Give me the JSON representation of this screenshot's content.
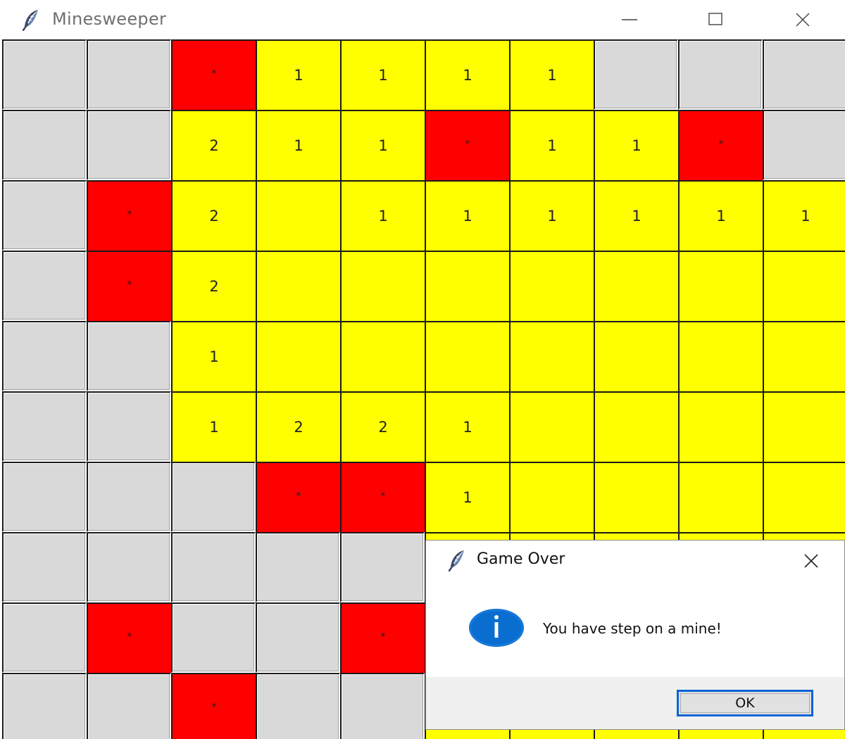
{
  "window": {
    "title": "Minesweeper",
    "icon": "feather-icon",
    "controls": [
      "minimize-icon",
      "maximize-icon",
      "close-icon"
    ]
  },
  "board": {
    "rows": 10,
    "cols": 10,
    "cell_colors": {
      "hidden": "#d9d9d9",
      "open": "#ffff00",
      "mine": "#ff0000"
    },
    "cells": [
      [
        {
          "s": "hidden",
          "t": ""
        },
        {
          "s": "hidden",
          "t": ""
        },
        {
          "s": "mine",
          "t": "*"
        },
        {
          "s": "open",
          "t": "1"
        },
        {
          "s": "open",
          "t": "1"
        },
        {
          "s": "open",
          "t": "1"
        },
        {
          "s": "open",
          "t": "1"
        },
        {
          "s": "hidden",
          "t": ""
        },
        {
          "s": "hidden",
          "t": ""
        },
        {
          "s": "hidden",
          "t": ""
        }
      ],
      [
        {
          "s": "hidden",
          "t": ""
        },
        {
          "s": "hidden",
          "t": ""
        },
        {
          "s": "open",
          "t": "2"
        },
        {
          "s": "open",
          "t": "1"
        },
        {
          "s": "open",
          "t": "1"
        },
        {
          "s": "mine",
          "t": "*"
        },
        {
          "s": "open",
          "t": "1"
        },
        {
          "s": "open",
          "t": "1"
        },
        {
          "s": "mine",
          "t": "*"
        },
        {
          "s": "hidden",
          "t": ""
        }
      ],
      [
        {
          "s": "hidden",
          "t": ""
        },
        {
          "s": "mine",
          "t": "*"
        },
        {
          "s": "open",
          "t": "2"
        },
        {
          "s": "open",
          "t": ""
        },
        {
          "s": "open",
          "t": "1"
        },
        {
          "s": "open",
          "t": "1"
        },
        {
          "s": "open",
          "t": "1"
        },
        {
          "s": "open",
          "t": "1"
        },
        {
          "s": "open",
          "t": "1"
        },
        {
          "s": "open",
          "t": "1"
        }
      ],
      [
        {
          "s": "hidden",
          "t": ""
        },
        {
          "s": "mine",
          "t": "*"
        },
        {
          "s": "open",
          "t": "2"
        },
        {
          "s": "open",
          "t": ""
        },
        {
          "s": "open",
          "t": ""
        },
        {
          "s": "open",
          "t": ""
        },
        {
          "s": "open",
          "t": ""
        },
        {
          "s": "open",
          "t": ""
        },
        {
          "s": "open",
          "t": ""
        },
        {
          "s": "open",
          "t": ""
        }
      ],
      [
        {
          "s": "hidden",
          "t": ""
        },
        {
          "s": "hidden",
          "t": ""
        },
        {
          "s": "open",
          "t": "1"
        },
        {
          "s": "open",
          "t": ""
        },
        {
          "s": "open",
          "t": ""
        },
        {
          "s": "open",
          "t": ""
        },
        {
          "s": "open",
          "t": ""
        },
        {
          "s": "open",
          "t": ""
        },
        {
          "s": "open",
          "t": ""
        },
        {
          "s": "open",
          "t": ""
        }
      ],
      [
        {
          "s": "hidden",
          "t": ""
        },
        {
          "s": "hidden",
          "t": ""
        },
        {
          "s": "open",
          "t": "1"
        },
        {
          "s": "open",
          "t": "2"
        },
        {
          "s": "open",
          "t": "2"
        },
        {
          "s": "open",
          "t": "1"
        },
        {
          "s": "open",
          "t": ""
        },
        {
          "s": "open",
          "t": ""
        },
        {
          "s": "open",
          "t": ""
        },
        {
          "s": "open",
          "t": ""
        }
      ],
      [
        {
          "s": "hidden",
          "t": ""
        },
        {
          "s": "hidden",
          "t": ""
        },
        {
          "s": "hidden",
          "t": ""
        },
        {
          "s": "mine",
          "t": "*"
        },
        {
          "s": "mine",
          "t": "*"
        },
        {
          "s": "open",
          "t": "1"
        },
        {
          "s": "open",
          "t": ""
        },
        {
          "s": "open",
          "t": ""
        },
        {
          "s": "open",
          "t": ""
        },
        {
          "s": "open",
          "t": ""
        }
      ],
      [
        {
          "s": "hidden",
          "t": ""
        },
        {
          "s": "hidden",
          "t": ""
        },
        {
          "s": "hidden",
          "t": ""
        },
        {
          "s": "hidden",
          "t": ""
        },
        {
          "s": "hidden",
          "t": ""
        },
        {
          "s": "open",
          "t": ""
        },
        {
          "s": "open",
          "t": ""
        },
        {
          "s": "open",
          "t": ""
        },
        {
          "s": "open",
          "t": ""
        },
        {
          "s": "open",
          "t": ""
        }
      ],
      [
        {
          "s": "hidden",
          "t": ""
        },
        {
          "s": "mine",
          "t": "*"
        },
        {
          "s": "hidden",
          "t": ""
        },
        {
          "s": "hidden",
          "t": ""
        },
        {
          "s": "mine",
          "t": "*"
        },
        {
          "s": "open",
          "t": ""
        },
        {
          "s": "open",
          "t": ""
        },
        {
          "s": "open",
          "t": ""
        },
        {
          "s": "open",
          "t": ""
        },
        {
          "s": "open",
          "t": ""
        }
      ],
      [
        {
          "s": "hidden",
          "t": ""
        },
        {
          "s": "hidden",
          "t": ""
        },
        {
          "s": "mine",
          "t": "*"
        },
        {
          "s": "hidden",
          "t": ""
        },
        {
          "s": "hidden",
          "t": ""
        },
        {
          "s": "open",
          "t": ""
        },
        {
          "s": "open",
          "t": ""
        },
        {
          "s": "open",
          "t": ""
        },
        {
          "s": "open",
          "t": ""
        },
        {
          "s": "open",
          "t": ""
        }
      ]
    ]
  },
  "dialog": {
    "title": "Game Over",
    "icon": "feather-icon",
    "message_icon": "info-icon",
    "message": "You have step on a mine!",
    "ok_label": "OK",
    "accent_color": "#0a64d8",
    "info_icon_color": "#0a6ed1"
  }
}
